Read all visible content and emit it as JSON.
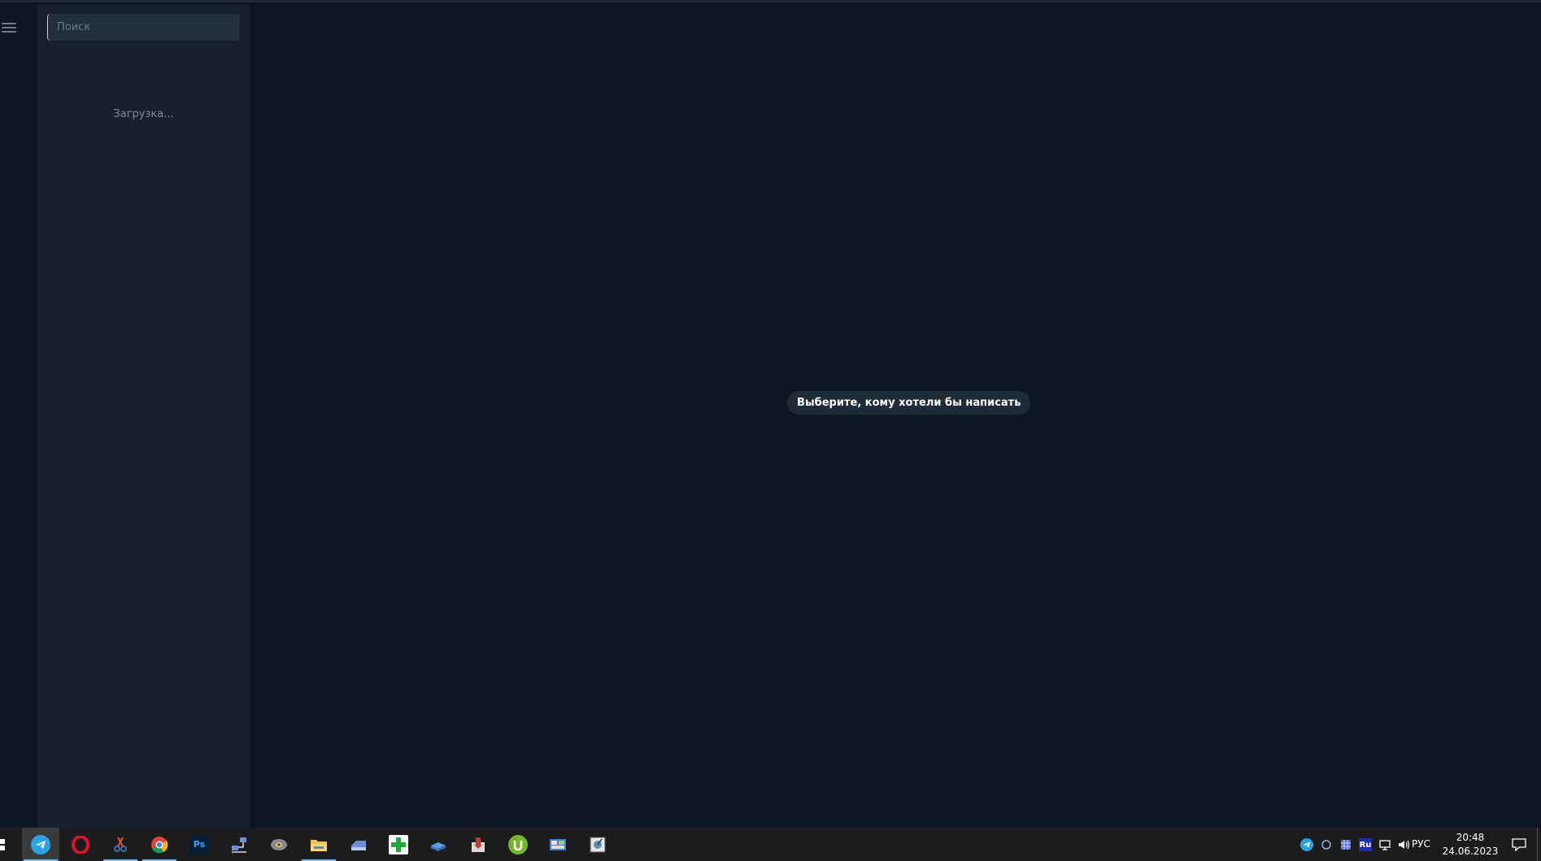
{
  "search": {
    "placeholder": "Поиск"
  },
  "sidebar": {
    "loading_text": "Загрузка..."
  },
  "main": {
    "empty_message": "Выберите, кому хотели бы написать"
  },
  "taskbar": {
    "apps": [
      {
        "name": "telegram-app-icon",
        "color": "#2aa3e0"
      },
      {
        "name": "opera-app-icon",
        "color": "#e0112b"
      },
      {
        "name": "scissors-app-icon",
        "color": "#e05a2a"
      },
      {
        "name": "chrome-app-icon",
        "color": "#4caf50"
      },
      {
        "name": "photoshop-app-icon",
        "color": "#001e36",
        "label": "Ps"
      },
      {
        "name": "network-app-icon",
        "color": "#3b6fb5"
      },
      {
        "name": "disk-app-icon",
        "color": "#9a9a9a"
      },
      {
        "name": "file-explorer-app-icon",
        "color": "#f2c14e"
      },
      {
        "name": "drive-app-icon",
        "color": "#6a8fd6"
      },
      {
        "name": "medical-cross-app-icon",
        "color": "#1faa3a"
      },
      {
        "name": "cloud-app-icon",
        "color": "#5aa0e6"
      },
      {
        "name": "installer-app-icon",
        "color": "#c0392b"
      },
      {
        "name": "utorrent-app-icon",
        "color": "#77b72e"
      },
      {
        "name": "control-panel-app-icon",
        "color": "#4a7fc4"
      },
      {
        "name": "disk-utility-app-icon",
        "color": "#6d8ea8"
      }
    ],
    "language": "РУС",
    "time": "20:48",
    "date": "24.06.2023"
  }
}
